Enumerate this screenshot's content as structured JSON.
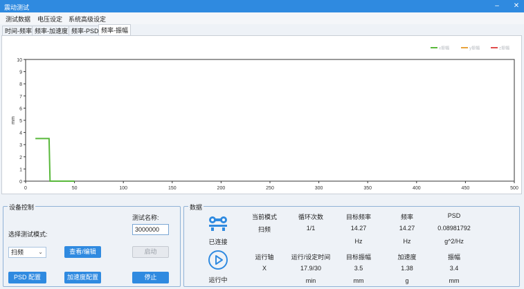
{
  "window": {
    "title": "震动测试"
  },
  "menu": [
    "测试数据",
    "电压设定",
    "系统高级设定"
  ],
  "tabs": [
    "时间-频率",
    "频率-加速度",
    "频率-PSD",
    "频率-振幅"
  ],
  "chart_data": {
    "type": "line",
    "x_ticks": [
      0,
      50,
      100,
      150,
      200,
      250,
      300,
      350,
      400,
      450,
      500
    ],
    "y_ticks": [
      0,
      1,
      2,
      3,
      4,
      5,
      6,
      7,
      8,
      9,
      10
    ],
    "xlim": [
      0,
      500
    ],
    "ylim": [
      0,
      10
    ],
    "ylabel": "mm",
    "legend_position": "top-right",
    "series": [
      {
        "name": "x振幅",
        "color": "#58b83a",
        "x": [
          10,
          24,
          25,
          50
        ],
        "y": [
          3.5,
          3.5,
          0,
          0
        ]
      },
      {
        "name": "y振幅",
        "color": "#e8a23c",
        "x": [],
        "y": []
      },
      {
        "name": "z振幅",
        "color": "#e04b4b",
        "x": [],
        "y": []
      }
    ]
  },
  "device_control": {
    "title": "设备控制",
    "test_name_label": "测试名称:",
    "test_name_value": "3000000",
    "mode_label": "选择测试模式:",
    "mode_value": "扫频",
    "view_edit_btn": "查看/编辑",
    "start_btn": "启动",
    "psd_btn": "PSD 配置",
    "accel_btn": "加速度配置",
    "stop_btn": "停止"
  },
  "data_panel": {
    "title": "数据",
    "connected_label": "已连接",
    "running_label": "运行中",
    "row1_headers": [
      "当前模式",
      "循环次数",
      "目标频率",
      "频率",
      "PSD"
    ],
    "row1_values": [
      "扫频",
      "1/1",
      "14.27",
      "14.27",
      "0.08981792"
    ],
    "row1_units": [
      "",
      "",
      "Hz",
      "Hz",
      "g^2/Hz"
    ],
    "row2_headers": [
      "运行轴",
      "运行/设定时间",
      "目标振幅",
      "加速度",
      "振幅"
    ],
    "row2_values": [
      "X",
      "17.9/30",
      "3.5",
      "1.38",
      "3.4"
    ],
    "row2_units": [
      "",
      "min",
      "mm",
      "g",
      "mm"
    ]
  }
}
